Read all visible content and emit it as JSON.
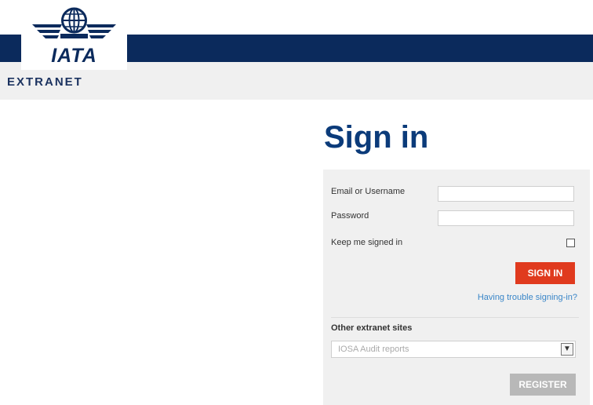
{
  "header": {
    "logo_text": "IATA",
    "subtitle": "EXTRANET"
  },
  "signin": {
    "title": "Sign in",
    "email_label": "Email or Username",
    "email_value": "",
    "password_label": "Password",
    "password_value": "",
    "keep_signed_label": "Keep me signed in",
    "keep_signed_checked": false,
    "signin_button": "SIGN IN",
    "trouble_link": "Having trouble signing-in?"
  },
  "other_sites": {
    "title": "Other extranet sites",
    "selected": "IOSA Audit reports",
    "register_button": "REGISTER"
  },
  "colors": {
    "brand_navy": "#0b2a5c",
    "title_blue": "#0b3b7a",
    "signin_red": "#e03a1e",
    "link_blue": "#3a86c8",
    "disabled_grey": "#b8b8b8"
  }
}
